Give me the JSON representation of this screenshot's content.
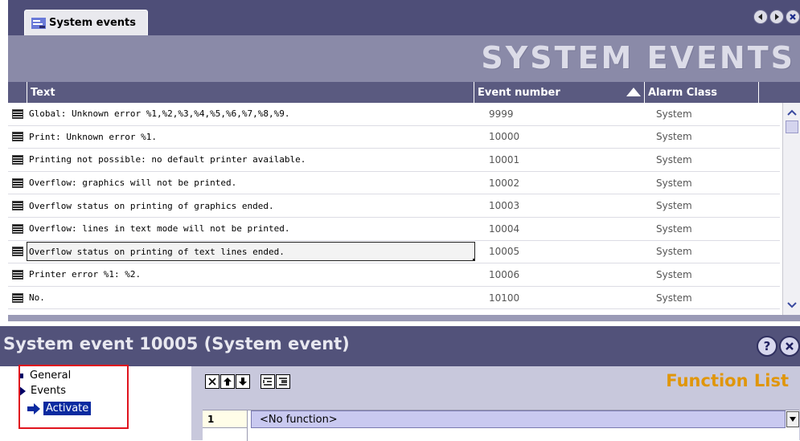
{
  "tab": {
    "label": "System events"
  },
  "banner": {
    "title": "SYSTEM EVENTS"
  },
  "table": {
    "headers": {
      "text": "Text",
      "event_number": "Event number",
      "alarm_class": "Alarm Class"
    },
    "sort": {
      "column": "Event number",
      "direction": "ascending"
    },
    "rows": [
      {
        "text": "Global: Unknown error %1,%2,%3,%4,%5,%6,%7,%8,%9.",
        "event_number": "9999",
        "alarm_class": "System"
      },
      {
        "text": "Print: Unknown error %1.",
        "event_number": "10000",
        "alarm_class": "System"
      },
      {
        "text": "Printing not possible: no default printer available.",
        "event_number": "10001",
        "alarm_class": "System"
      },
      {
        "text": "Overflow: graphics will not be printed.",
        "event_number": "10002",
        "alarm_class": "System"
      },
      {
        "text": "Overflow status on printing of graphics ended.",
        "event_number": "10003",
        "alarm_class": "System"
      },
      {
        "text": "Overflow: lines in text mode will not be printed.",
        "event_number": "10004",
        "alarm_class": "System"
      },
      {
        "text": "Overflow status on printing of text lines ended.",
        "event_number": "10005",
        "alarm_class": "System"
      },
      {
        "text": "Printer error %1: %2.",
        "event_number": "10006",
        "alarm_class": "System"
      },
      {
        "text": "No.",
        "event_number": "10100",
        "alarm_class": "System"
      }
    ]
  },
  "properties": {
    "title": "System event 10005 (System event)",
    "tree": {
      "general": "General",
      "events": "Events",
      "activate": "Activate"
    },
    "function_list": {
      "title": "Function List",
      "rows": [
        {
          "number": "1",
          "function": "<No function>"
        }
      ]
    }
  },
  "colors": {
    "highlight_box": "#e0141e",
    "function_list_title": "#e0960a",
    "header_bg": "#5a5a80"
  }
}
